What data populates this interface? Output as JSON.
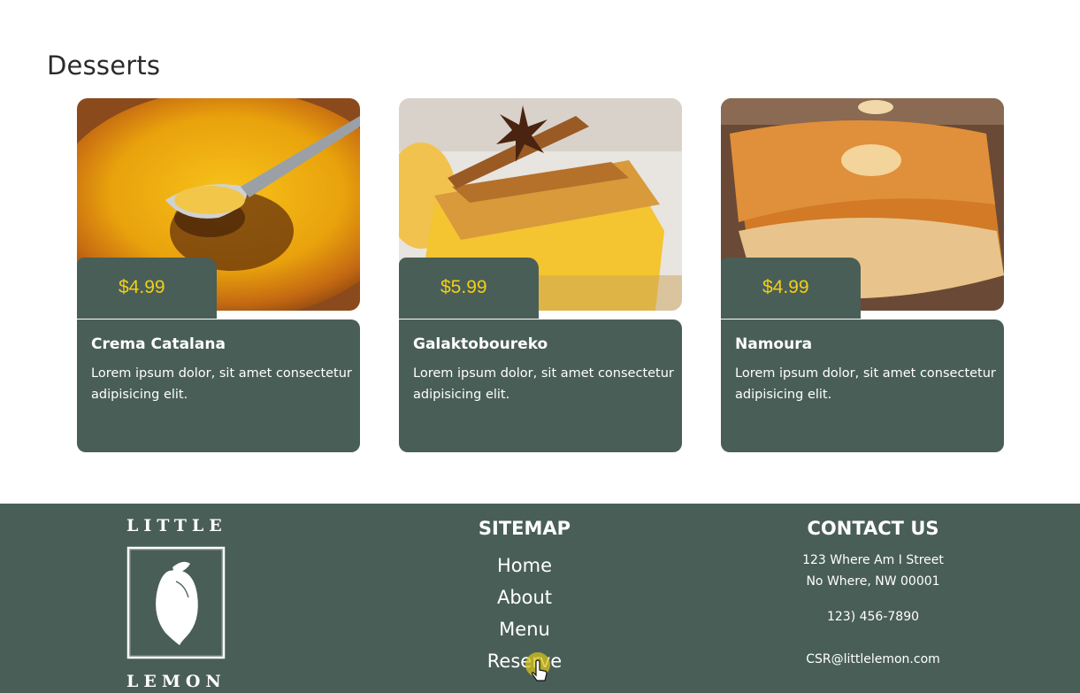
{
  "section": {
    "title": "Desserts"
  },
  "cards": [
    {
      "name": "Crema Catalana",
      "price": "$4.99",
      "description": "Lorem ipsum dolor, sit amet consectetur adipisicing elit."
    },
    {
      "name": "Galaktoboureko",
      "price": "$5.99",
      "description": "Lorem ipsum dolor, sit amet consectetur adipisicing elit."
    },
    {
      "name": "Namoura",
      "price": "$4.99",
      "description": "Lorem ipsum dolor, sit amet consectetur adipisicing elit."
    }
  ],
  "footer": {
    "logo": {
      "top_word": "LITTLE",
      "bottom_word": "LEMON",
      "icon": "lemon-icon"
    },
    "sitemap": {
      "heading": "SITEMAP",
      "links": [
        "Home",
        "About",
        "Menu",
        "Reserve"
      ]
    },
    "contact": {
      "heading": "CONTACT US",
      "address_line1": "123 Where Am I Street",
      "address_line2": "No Where, NW 00001",
      "phone": "123) 456-7890",
      "email": "CSR@littlelemon.com"
    }
  },
  "colors": {
    "brand_green": "#495e57",
    "brand_yellow": "#f4ce14",
    "background": "#ffffff"
  }
}
